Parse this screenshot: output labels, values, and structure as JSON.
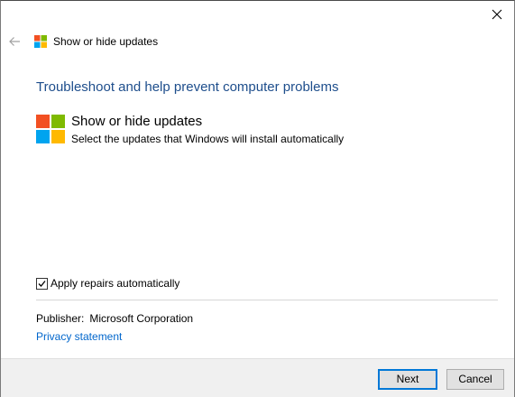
{
  "window": {
    "title": "Show or hide updates",
    "close_icon": "close-icon",
    "back_icon": "back-arrow-icon"
  },
  "main": {
    "heading": "Troubleshoot and help prevent computer problems",
    "tool": {
      "icon": "windows-logo-icon",
      "title": "Show or hide updates",
      "description": "Select the updates that Windows will install automatically"
    }
  },
  "options": {
    "apply_repairs_label": "Apply repairs automatically",
    "apply_repairs_checked": true
  },
  "info": {
    "publisher_label": "Publisher:",
    "publisher_value": "Microsoft Corporation",
    "privacy_link": "Privacy statement"
  },
  "footer": {
    "next_label": "Next",
    "cancel_label": "Cancel"
  },
  "colors": {
    "heading": "#1e4e8c",
    "link": "#0066cc",
    "accent": "#0078d7",
    "logo_red": "#f25022",
    "logo_green": "#7fba00",
    "logo_blue": "#00a4ef",
    "logo_yellow": "#ffb900"
  }
}
